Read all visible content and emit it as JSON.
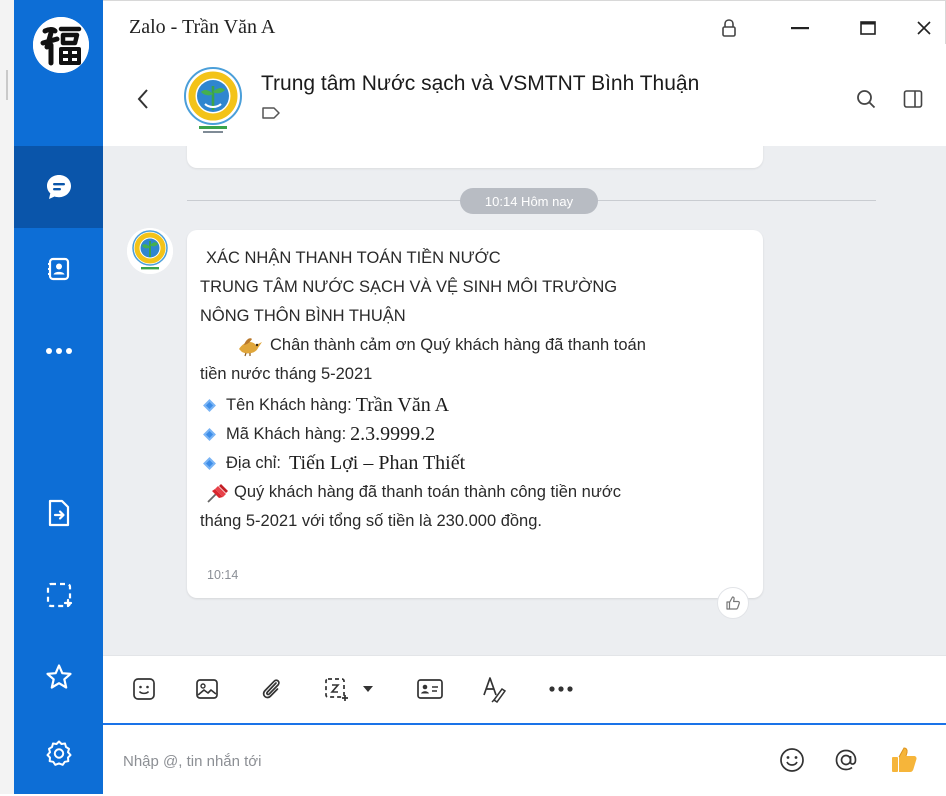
{
  "window": {
    "title": "Zalo - Trần Văn A"
  },
  "conversation": {
    "name": "Trung tâm Nước sạch và VSMTNT Bình Thuận"
  },
  "chat": {
    "date_divider": "10:14 Hôm nay",
    "message": {
      "title_line1": "XÁC NHẬN THANH TOÁN TIỀN NƯỚC",
      "title_line2": "TRUNG TÂM NƯỚC SẠCH VÀ VỆ SINH MÔI TRƯỜNG",
      "title_line3": "NÔNG THÔN BÌNH THUẬN",
      "thanks_line1": "Chân thành cảm ơn Quý khách hàng đã thanh toán",
      "thanks_line2": "tiền nước tháng 5-2021",
      "customer_name_label": "Tên Khách hàng:",
      "customer_name_value": "Trần Văn A",
      "customer_code_label": "Mã Khách hàng:",
      "customer_code_value": "2.3.9999.2",
      "address_label": "Địa chỉ:",
      "address_value": "Tiến Lợi – Phan Thiết",
      "paid_line1": "Quý khách hàng đã thanh toán thành công tiền nước",
      "paid_line2": "tháng 5-2021 với tổng số tiền là 230.000 đồng.",
      "time": "10:14"
    }
  },
  "input": {
    "placeholder": "Nhập @, tin nhắn tới"
  },
  "icons": {
    "sidebar": [
      "chat-icon",
      "contacts-icon",
      "more-icon",
      "file-transfer-icon",
      "screenshot-icon",
      "star-icon",
      "settings-icon"
    ],
    "toolbar": [
      "sticker-icon",
      "image-icon",
      "attachment-icon",
      "screen-capture-icon",
      "caret-down-icon",
      "contact-card-icon",
      "text-format-icon",
      "more-icon"
    ],
    "input": [
      "emoji-icon",
      "mention-icon",
      "thumbs-up-icon"
    ]
  },
  "colors": {
    "sidebar": "#0d6ed6",
    "sidebar_active": "#0a55aa",
    "chat_background": "#eceef1",
    "accent": "#1a73e8",
    "thumbs_up": "#f6b53a"
  }
}
